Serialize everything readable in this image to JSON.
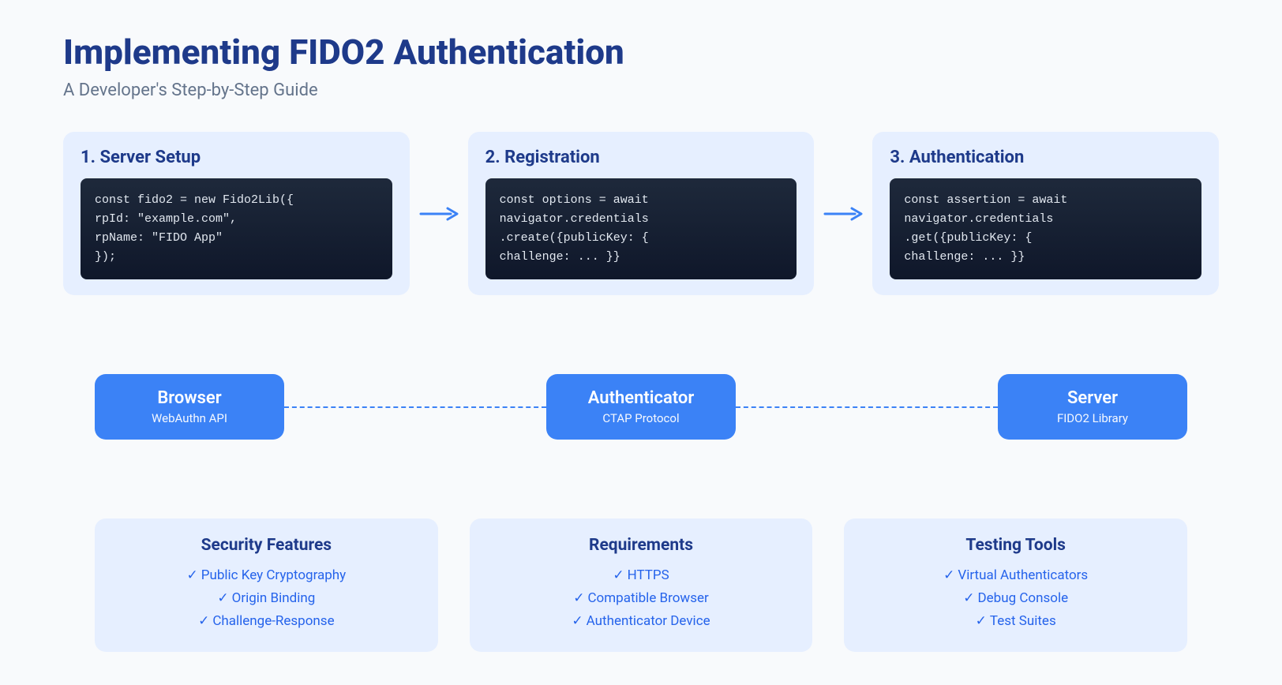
{
  "title": "Implementing FIDO2 Authentication",
  "subtitle": "A Developer's Step-by-Step Guide",
  "steps": [
    {
      "title": "1. Server Setup",
      "code": "const fido2 = new Fido2Lib({\nrpId: \"example.com\",\nrpName: \"FIDO App\"\n});"
    },
    {
      "title": "2. Registration",
      "code": "const options = await\nnavigator.credentials\n.create({publicKey: {\nchallenge: ... }}"
    },
    {
      "title": "3. Authentication",
      "code": "const assertion = await\nnavigator.credentials\n.get({publicKey: {\nchallenge: ... }}"
    }
  ],
  "actors": [
    {
      "title": "Browser",
      "subtitle": "WebAuthn API"
    },
    {
      "title": "Authenticator",
      "subtitle": "CTAP Protocol"
    },
    {
      "title": "Server",
      "subtitle": "FIDO2 Library"
    }
  ],
  "info_cards": [
    {
      "title": "Security Features",
      "items": [
        "Public Key Cryptography",
        "Origin Binding",
        "Challenge-Response"
      ]
    },
    {
      "title": "Requirements",
      "items": [
        "HTTPS",
        "Compatible Browser",
        "Authenticator Device"
      ]
    },
    {
      "title": "Testing Tools",
      "items": [
        "Virtual Authenticators",
        "Debug Console",
        "Test Suites"
      ]
    }
  ]
}
